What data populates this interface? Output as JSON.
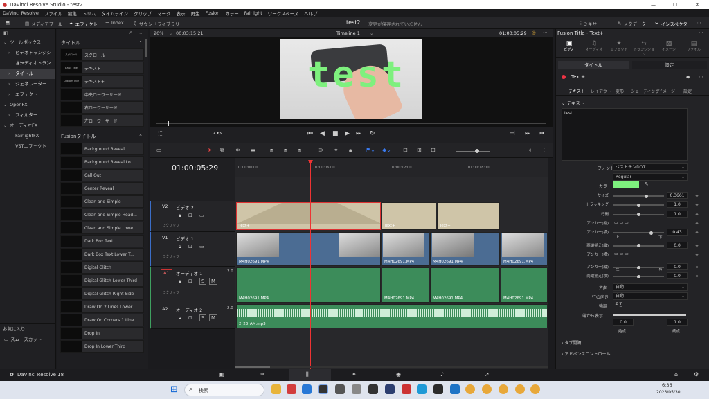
{
  "window": {
    "title": "DaVinci Resolve Studio - test2",
    "min": "—",
    "max": "☐",
    "close": "✕"
  },
  "menu": [
    "DaVinci Resolve",
    "ファイル",
    "編集",
    "トリム",
    "タイムライン",
    "クリップ",
    "マーク",
    "表示",
    "再生",
    "Fusion",
    "カラー",
    "Fairlight",
    "ワークスペース",
    "ヘルプ"
  ],
  "toolbar": {
    "media_pool": "メディアプール",
    "effects": "エフェクト",
    "index": "Index",
    "sound_library": "サウンドライブラリ",
    "project": "test2",
    "project_status": "変更が保存されていません",
    "mixer": "ミキサー",
    "metadata": "メタデータ",
    "inspector": "インスペクタ"
  },
  "left_tree": [
    {
      "label": "ツールボックス",
      "chev": "⌄"
    },
    {
      "label": "ビデオトランジション",
      "chev": "›",
      "indent": true
    },
    {
      "label": "オーディオトランジション",
      "chev": "",
      "indent": true
    },
    {
      "label": "タイトル",
      "chev": "›",
      "indent": true,
      "sel": true
    },
    {
      "label": "ジェネレーター",
      "chev": "›",
      "indent": true
    },
    {
      "label": "エフェクト",
      "chev": "›",
      "indent": true
    },
    {
      "label": "OpenFX",
      "chev": "⌄"
    },
    {
      "label": "フィルター",
      "chev": "›",
      "indent": true
    },
    {
      "label": "オーディオFX",
      "chev": "⌄"
    },
    {
      "label": "FairlightFX",
      "chev": "",
      "indent": true
    },
    {
      "label": "VSTエフェクト",
      "chev": "",
      "indent": true
    }
  ],
  "favorites": {
    "header": "お気に入り",
    "shortcut": "スムースカット"
  },
  "titles_section": "タイトル",
  "titles": [
    {
      "thumb": "スクロール",
      "label": "スクロール"
    },
    {
      "thumb": "Basic Title",
      "label": "テキスト"
    },
    {
      "thumb": "Custom Title",
      "label": "テキスト+"
    },
    {
      "thumb": "",
      "label": "中央ローワーサード"
    },
    {
      "thumb": "",
      "label": "右ローワーサード"
    },
    {
      "thumb": "",
      "label": "左ローワーサード"
    }
  ],
  "fusion_section": "Fusionタイトル",
  "fusion_titles": [
    "Background Reveal",
    "Background Reveal Lo...",
    "Call Out",
    "Center Reveal",
    "Clean and Simple",
    "Clean and Simple Head...",
    "Clean and Simple Lowe...",
    "Dark Box Text",
    "Dark Box Text Lower T...",
    "Digital Glitch",
    "Digital Glitch Lower Third",
    "Digital Glitch Right Side",
    "Draw On 2 Lines Lower...",
    "Draw On Corners 1 Line",
    "Drop In",
    "Drop In Lower Third"
  ],
  "viewer": {
    "zoom": "20%",
    "timecode_left": "00:03:15:21",
    "timeline_name": "Timeline 1",
    "timecode_right": "01:00:05:29",
    "overlay_text": "test"
  },
  "timeline": {
    "timecode": "01:00:05:29",
    "ruler": [
      "01:00:00:00",
      "01:00:06:00",
      "01:00:12:00",
      "01:00:18:00"
    ]
  },
  "tracks": [
    {
      "id": "V2",
      "name": "ビデオ 2",
      "clips": "3クリップ",
      "type": "video"
    },
    {
      "id": "V1",
      "name": "ビデオ 1",
      "clips": "5クリップ",
      "type": "video"
    },
    {
      "id": "A1",
      "name": "オーディオ 1",
      "clips": "3クリップ",
      "level": "2.0",
      "type": "audio"
    },
    {
      "id": "A2",
      "name": "オーディオ 2",
      "clips": "",
      "level": "2.0",
      "type": "audio"
    }
  ],
  "clips": {
    "text_plus": "Text+",
    "video": "M4H02691.MP4",
    "audio": "M4H02691.MP4",
    "music": "2_23_AM.mp3"
  },
  "inspector": {
    "title": "Fusion Title - Text+",
    "tabs": [
      "ビデオ",
      "オーディオ",
      "エフェクト",
      "トランジション",
      "イメージ",
      "ファイル"
    ],
    "sub_tabs": [
      "タイトル",
      "設定"
    ],
    "node": "Text+",
    "text_tabs": [
      "テキスト",
      "レイアウト",
      "変形",
      "シェーディング",
      "イメージ",
      "設定"
    ],
    "section_text": "テキスト",
    "text_value": "test",
    "font_label": "フォント",
    "font_value": "ベストテンDOT",
    "style_value": "Regular",
    "color_label": "カラー",
    "color": "#7ef07e",
    "params": [
      {
        "label": "サイズ",
        "value": "0.3661"
      },
      {
        "label": "トラッキング",
        "value": "1.0"
      },
      {
        "label": "行間",
        "value": "1.0"
      },
      {
        "label": "アンカー(縦)",
        "value": ""
      },
      {
        "label": "アンカー(横)",
        "value": "0.43"
      },
      {
        "label": "両端揃え(縦)",
        "value": "0.0"
      },
      {
        "label": "アンカー(横)",
        "value": ""
      },
      {
        "label": "アンカー(縦)",
        "value": "0.0"
      },
      {
        "label": "両端揃え(横)",
        "value": "0.0"
      }
    ],
    "dir_top": "上",
    "dir_bottom": "下",
    "dir_left": "左",
    "dir_right": "右",
    "direction_label": "方向",
    "direction_value": "自動",
    "line_dir_label": "行の向き",
    "line_dir_value": "自動",
    "emphasis_label": "強調",
    "write_label": "端から表示",
    "start_value": "0.0",
    "end_value": "1.0",
    "start_label": "始点",
    "end_label": "終点",
    "tab_spacing": "タブ間隔",
    "advanced": "アドバンスコントロール"
  },
  "resolve": {
    "brand": "DaVinci Resolve 18"
  },
  "taskbar": {
    "search": "検索",
    "time": "6:36",
    "date": "2023/05/30"
  }
}
